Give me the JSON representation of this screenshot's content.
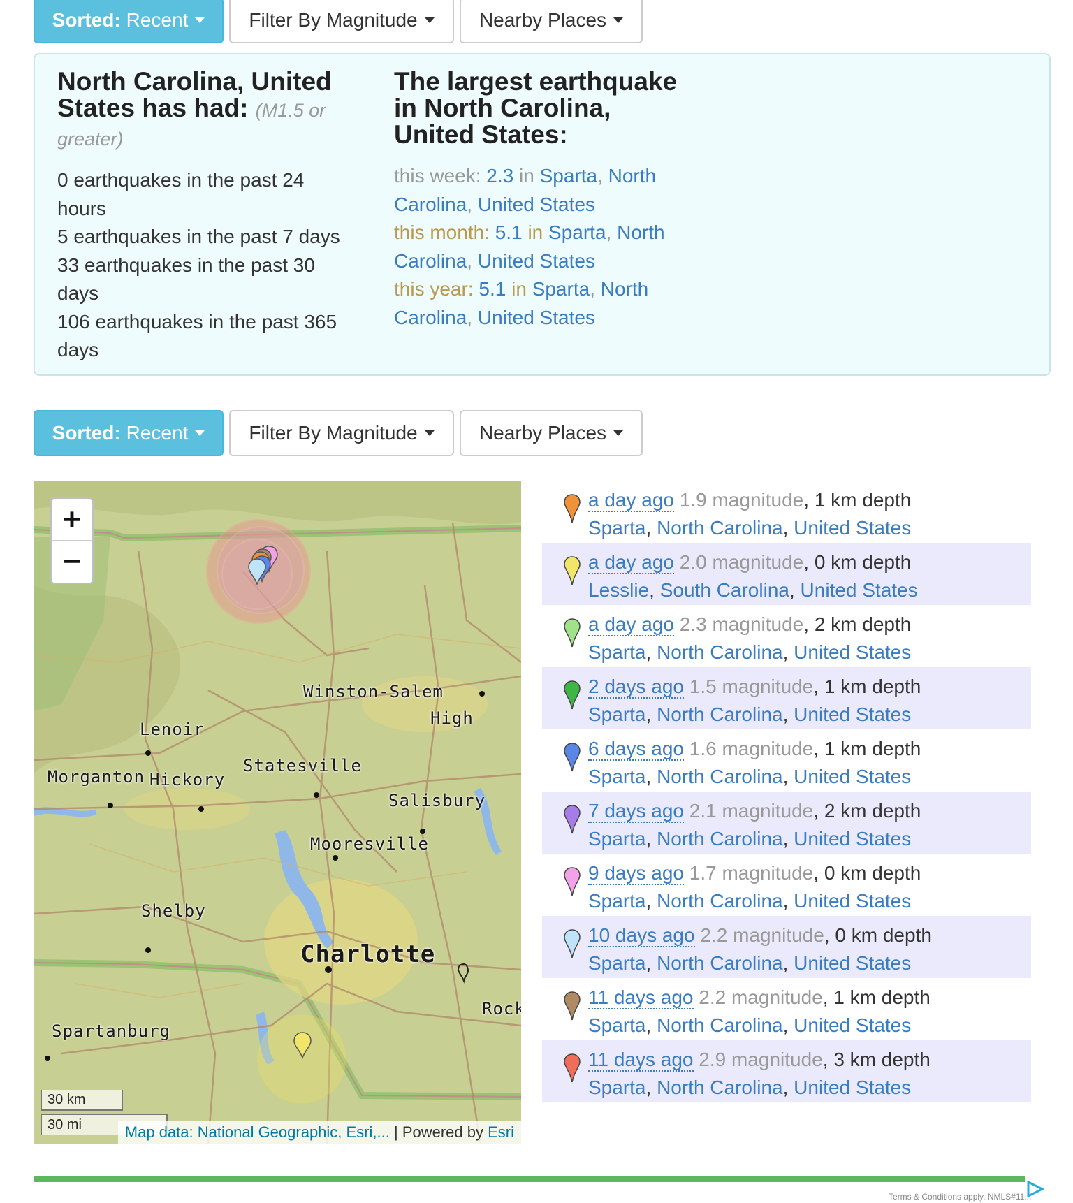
{
  "toolbar": {
    "sort_label": "Sorted:",
    "sort_value": "Recent",
    "filter_label": "Filter By Magnitude",
    "nearby_label": "Nearby Places"
  },
  "summary": {
    "title": "North Carolina, United States has had:",
    "note": "(M1.5 or greater)",
    "stats": [
      "0 earthquakes in the past 24 hours",
      "5 earthquakes in the past 7 days",
      "33 earthquakes in the past 30 days",
      "106 earthquakes in the past 365 days"
    ]
  },
  "largest": {
    "title": "The largest earthquake in North Carolina, United States:",
    "items": [
      {
        "label": "this week:",
        "mag": "2.3",
        "in": "in",
        "city": "Sparta",
        "region": "North Carolina",
        "country": "United States"
      },
      {
        "label": "this month:",
        "mag": "5.1",
        "in": "in",
        "city": "Sparta",
        "region": "North Carolina",
        "country": "United States"
      },
      {
        "label": "this year:",
        "mag": "5.1",
        "in": "in",
        "city": "Sparta",
        "region": "North Carolina",
        "country": "United States"
      }
    ]
  },
  "map": {
    "zoom_in": "+",
    "zoom_out": "−",
    "scale_km": "30 km",
    "scale_mi": "30 mi",
    "attribution_link": "Map data: National Geographic, Esri,...",
    "attribution_sep": " | Powered by ",
    "attribution_esri": "Esri",
    "places": [
      "Winston-Salem",
      "High",
      "Lenoir",
      "Morganton",
      "Hickory",
      "Statesville",
      "Salisbury",
      "Mooresville",
      "Shelby",
      "Charlotte",
      "Rock",
      "Spartanburg"
    ]
  },
  "quakes": [
    {
      "ago": "a day ago",
      "mag": "1.9 magnitude",
      "depth": "1 km depth",
      "city": "Sparta",
      "region": "North Carolina",
      "country": "United States",
      "color": "#f0923a"
    },
    {
      "ago": "a day ago",
      "mag": "2.0 magnitude",
      "depth": "0 km depth",
      "city": "Lesslie",
      "region": "South Carolina",
      "country": "United States",
      "color": "#f2e66a"
    },
    {
      "ago": "a day ago",
      "mag": "2.3 magnitude",
      "depth": "2 km depth",
      "city": "Sparta",
      "region": "North Carolina",
      "country": "United States",
      "color": "#9fe28a"
    },
    {
      "ago": "2 days ago",
      "mag": "1.5 magnitude",
      "depth": "1 km depth",
      "city": "Sparta",
      "region": "North Carolina",
      "country": "United States",
      "color": "#3fb545"
    },
    {
      "ago": "6 days ago",
      "mag": "1.6 magnitude",
      "depth": "1 km depth",
      "city": "Sparta",
      "region": "North Carolina",
      "country": "United States",
      "color": "#5a86e6"
    },
    {
      "ago": "7 days ago",
      "mag": "2.1 magnitude",
      "depth": "2 km depth",
      "city": "Sparta",
      "region": "North Carolina",
      "country": "United States",
      "color": "#a67de8"
    },
    {
      "ago": "9 days ago",
      "mag": "1.7 magnitude",
      "depth": "0 km depth",
      "city": "Sparta",
      "region": "North Carolina",
      "country": "United States",
      "color": "#f2a2e8"
    },
    {
      "ago": "10 days ago",
      "mag": "2.2 magnitude",
      "depth": "0 km depth",
      "city": "Sparta",
      "region": "North Carolina",
      "country": "United States",
      "color": "#bfe3f8"
    },
    {
      "ago": "11 days ago",
      "mag": "2.2 magnitude",
      "depth": "1 km depth",
      "city": "Sparta",
      "region": "North Carolina",
      "country": "United States",
      "color": "#b08a62"
    },
    {
      "ago": "11 days ago",
      "mag": "2.9 magnitude",
      "depth": "3 km depth",
      "city": "Sparta",
      "region": "North Carolina",
      "country": "United States",
      "color": "#ee6e5a"
    }
  ],
  "footer": {
    "terms": "Terms & Conditions apply. NMLS#11..."
  }
}
